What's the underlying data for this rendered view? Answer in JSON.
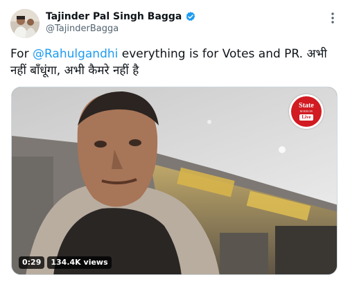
{
  "author": {
    "display_name": "Tajinder Pal Singh Bagga",
    "handle": "@TajinderBagga",
    "verified": true
  },
  "tweet": {
    "prefix": "For ",
    "mention": "@Rahulgandhi",
    "body_line1_rest": " everything is for Votes and PR. अभी",
    "body_line2": "नहीं बाँधूंगा, अभी कैमरे नहीं है"
  },
  "media": {
    "type": "video",
    "duration": "0:29",
    "views": "134.4K views",
    "watermark": {
      "top": "State",
      "middle": "MIRROR",
      "bottom": "Live"
    }
  },
  "icons": {
    "verified": "verified-badge-icon",
    "more": "more-options-icon"
  },
  "colors": {
    "mention": "#1d9bf0",
    "verified": "#1d9bf0",
    "handle": "#536471",
    "text": "#0f1419"
  }
}
